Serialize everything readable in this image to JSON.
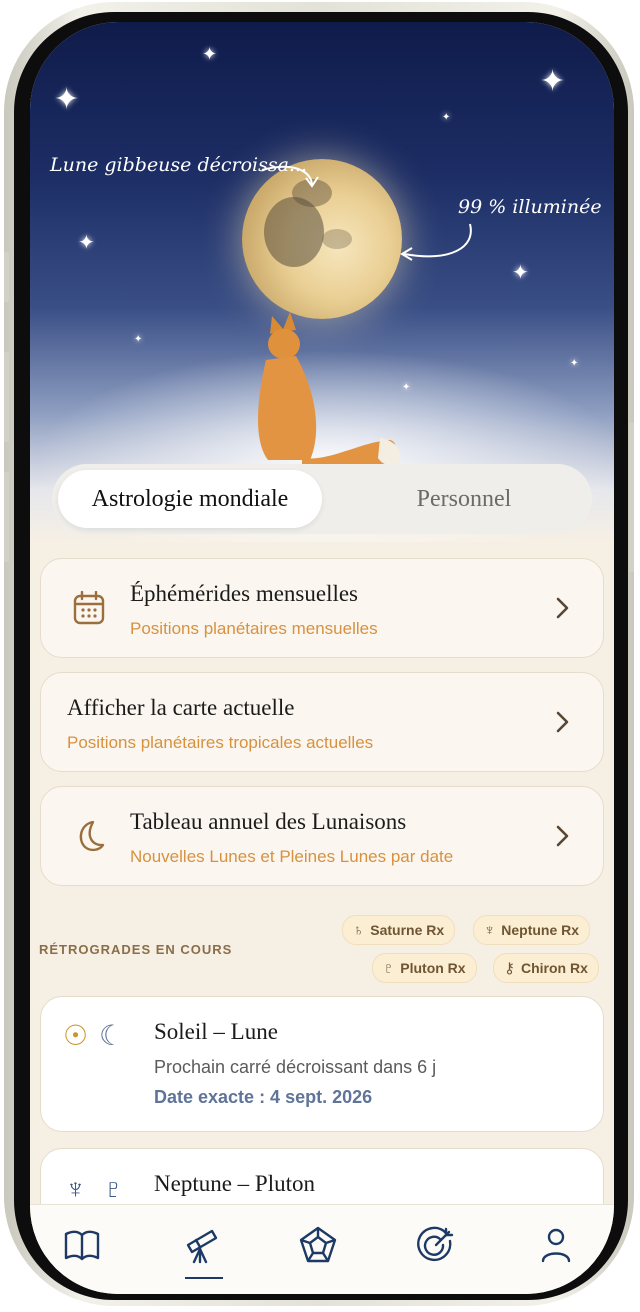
{
  "hero": {
    "moon_phase_label": "Lune gibbeuse décroissa...",
    "illumination_label": "99 % illuminée"
  },
  "tabs": [
    {
      "label": "Astrologie mondiale",
      "active": true
    },
    {
      "label": "Personnel",
      "active": false
    }
  ],
  "menu": [
    {
      "title": "Éphémérides mensuelles",
      "subtitle": "Positions planétaires mensuelles",
      "icon": "calendar-icon"
    },
    {
      "title": "Afficher la carte actuelle",
      "subtitle": "Positions planétaires tropicales actuelles",
      "icon": ""
    },
    {
      "title": "Tableau annuel des Lunaisons",
      "subtitle": "Nouvelles Lunes et Pleines Lunes par date",
      "icon": "moon-icon"
    }
  ],
  "retrogrades": {
    "heading": "RÉTROGRADES EN COURS",
    "chips": [
      {
        "glyph": "♄",
        "label": "Saturne Rx"
      },
      {
        "glyph": "♆",
        "label": "Neptune Rx"
      },
      {
        "glyph": "♇",
        "label": "Pluton Rx"
      },
      {
        "glyph": "⚷",
        "label": "Chiron Rx"
      }
    ]
  },
  "aspects": [
    {
      "glyph1": "☉",
      "glyph2": "☾",
      "title": "Soleil – Lune",
      "detail": "Prochain carré décroissant dans 6 j",
      "date": "Date exacte : 4 sept. 2026"
    },
    {
      "glyph1": "♆",
      "glyph2": "♇",
      "title": "Neptune – Pluton"
    }
  ],
  "nav": [
    {
      "icon": "book-icon",
      "active": false
    },
    {
      "icon": "telescope-icon",
      "active": true
    },
    {
      "icon": "pentagon-icon",
      "active": false
    },
    {
      "icon": "target-icon",
      "active": false
    },
    {
      "icon": "user-icon",
      "active": false
    }
  ],
  "colors": {
    "accent": "#d7913f",
    "navy": "#1d3a66",
    "date_blue": "#5f7498",
    "chip_bg": "#fbeed3",
    "glyph_gold": "#c9962e"
  }
}
